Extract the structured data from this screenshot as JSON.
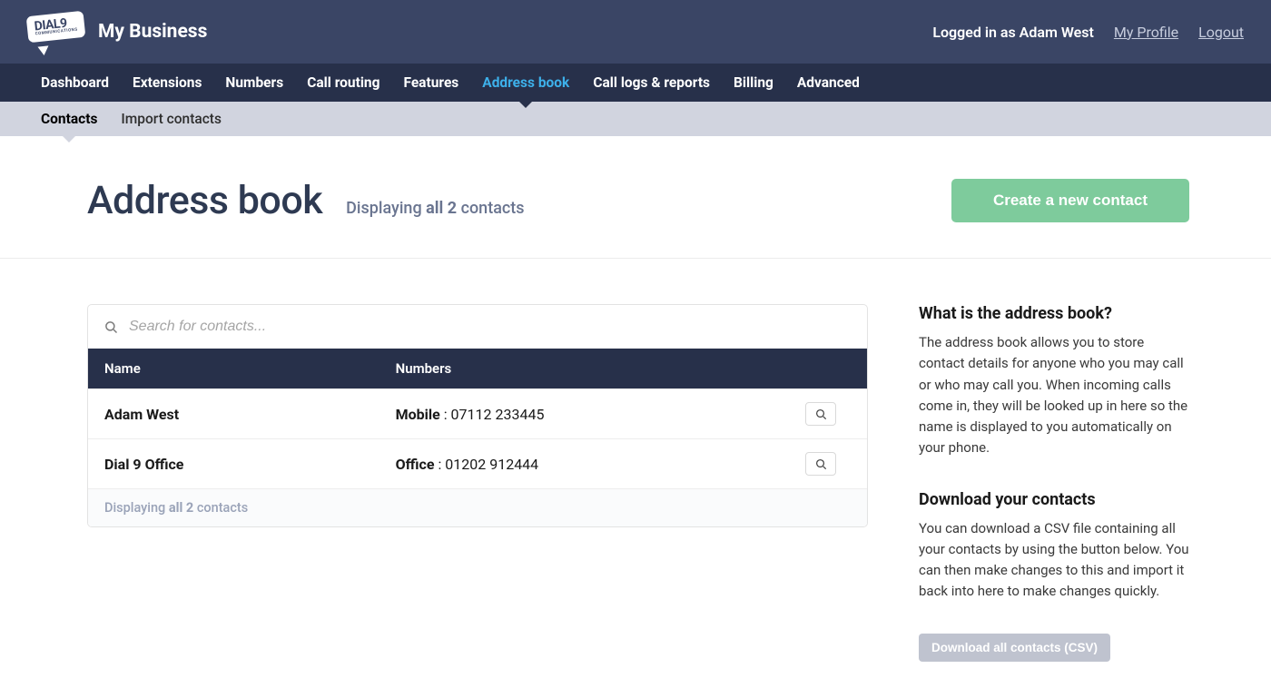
{
  "logo": {
    "brand": "DIAL9",
    "tagline": "COMMUNICATIONS"
  },
  "business_name": "My Business",
  "header": {
    "logged_in_as": "Logged in as Adam West",
    "my_profile": "My Profile",
    "logout": "Logout"
  },
  "nav": {
    "items": [
      "Dashboard",
      "Extensions",
      "Numbers",
      "Call routing",
      "Features",
      "Address book",
      "Call logs & reports",
      "Billing",
      "Advanced"
    ],
    "active_index": 5
  },
  "subnav": {
    "items": [
      "Contacts",
      "Import contacts"
    ],
    "active_index": 0
  },
  "page": {
    "title": "Address book",
    "displaying_prefix": "Displaying ",
    "displaying_bold": "all 2",
    "displaying_suffix": " contacts",
    "create_button": "Create a new contact"
  },
  "search": {
    "placeholder": "Search for contacts..."
  },
  "table": {
    "headers": {
      "name": "Name",
      "numbers": "Numbers"
    },
    "rows": [
      {
        "name": "Adam West",
        "number_label": "Mobile",
        "number_sep": " : ",
        "number_value": "07112 233445"
      },
      {
        "name": "Dial 9 Office",
        "number_label": "Office",
        "number_sep": " : ",
        "number_value": "01202 912444"
      }
    ],
    "footer_prefix": "Displaying ",
    "footer_bold": "all 2",
    "footer_suffix": " contacts"
  },
  "sidebar": {
    "h1": "What is the address book?",
    "p1": "The address book allows you to store contact details for anyone who you may call or who may call you. When incoming calls come in, they will be looked up in here so the name is displayed to you automatically on your phone.",
    "h2": "Download your contacts",
    "p2": "You can download a CSV file containing all your contacts by using the button below. You can then make changes to this and import it back into here to make changes quickly.",
    "download_btn": "Download all contacts (CSV)"
  }
}
